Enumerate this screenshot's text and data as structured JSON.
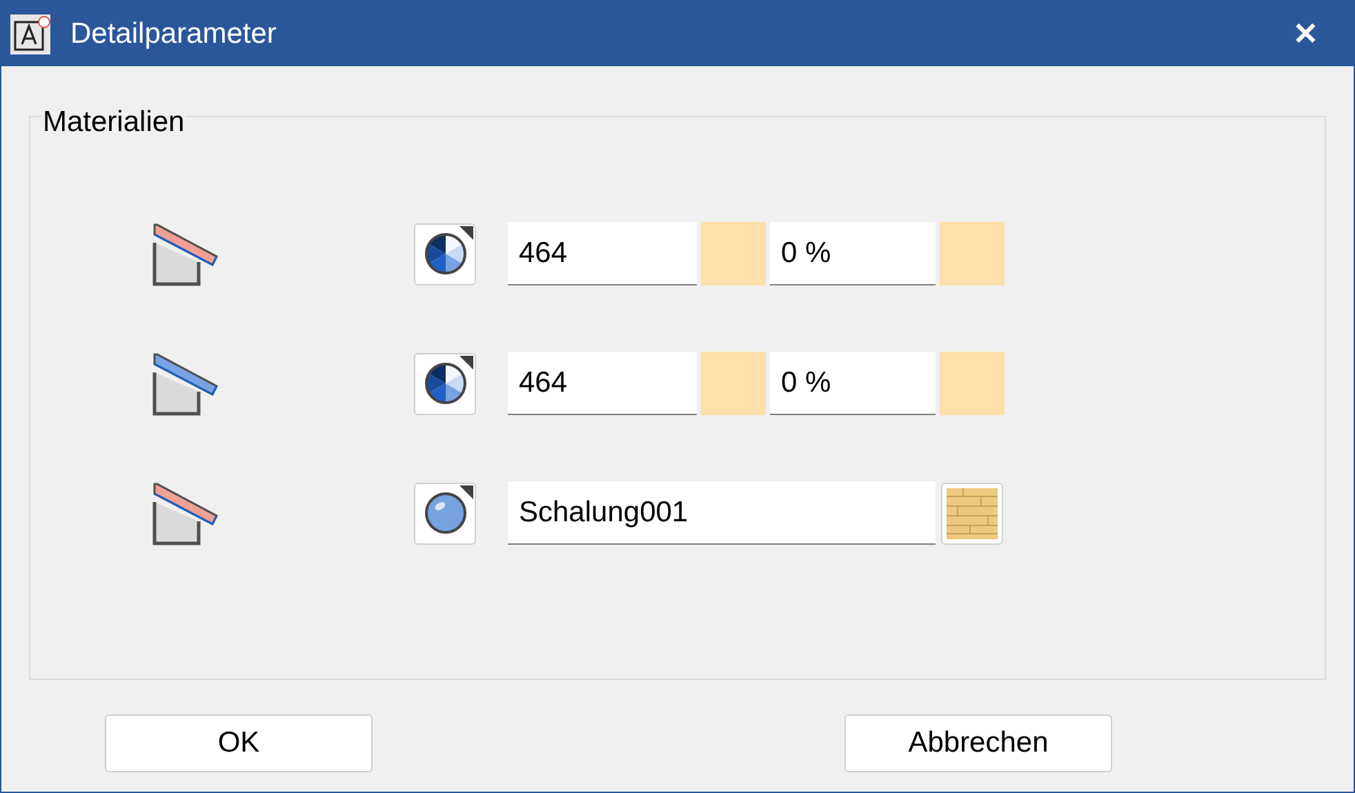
{
  "window": {
    "title": "Detailparameter",
    "close": "✕"
  },
  "group": {
    "title": "Materialien"
  },
  "rows": [
    {
      "kind": "color",
      "roof": {
        "color": "#eea095"
      },
      "material": {
        "kind": "palette"
      },
      "value": "464",
      "swatch": {
        "color": "#ffdfac"
      },
      "percent": "0 %",
      "percent_swatch": {
        "color": "#ffdfac"
      }
    },
    {
      "kind": "color",
      "roof": {
        "color": "#78a2e0"
      },
      "material": {
        "kind": "palette"
      },
      "value": "464",
      "swatch": {
        "color": "#ffdfac"
      },
      "percent": "0 %",
      "percent_swatch": {
        "color": "#ffdfac"
      }
    },
    {
      "kind": "texture",
      "roof": {
        "color": "#eea095"
      },
      "material": {
        "kind": "sphere"
      },
      "value": "Schalung001"
    }
  ],
  "buttons": [
    "OK",
    "Abbrechen"
  ]
}
